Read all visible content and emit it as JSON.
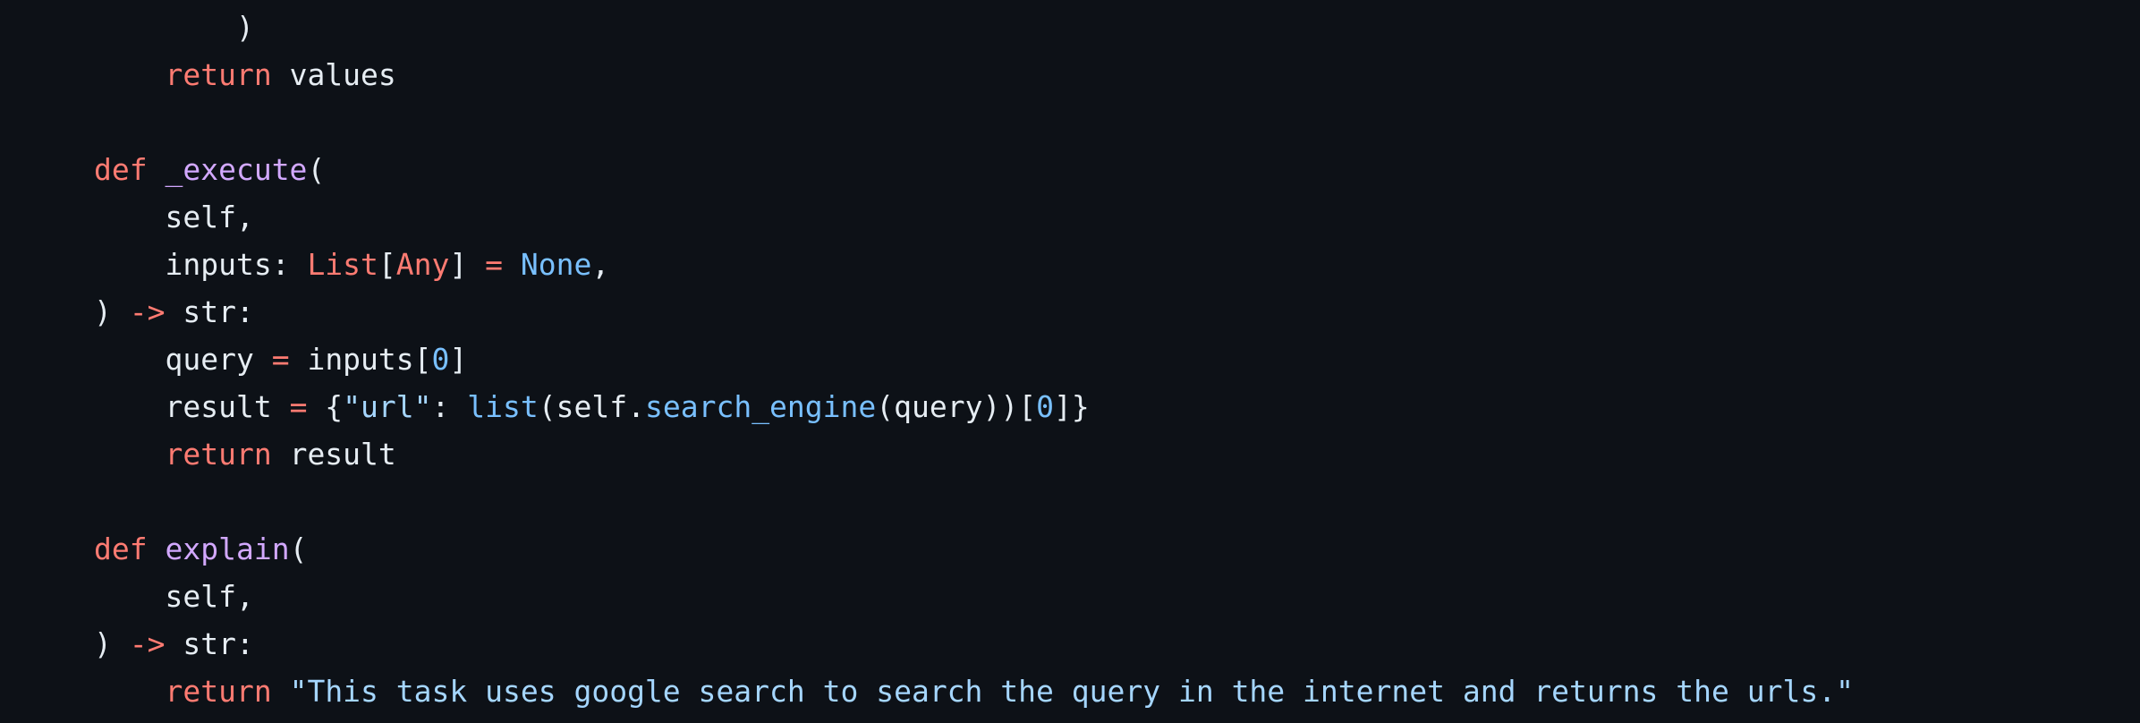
{
  "code_view": {
    "lines": [
      {
        "indent": "        ",
        "tokens": [
          {
            "text": ")",
            "kind": "plain"
          }
        ]
      },
      {
        "indent": "    ",
        "tokens": [
          {
            "text": "return",
            "kind": "keyword"
          },
          {
            "text": " values",
            "kind": "plain"
          }
        ]
      },
      {
        "indent": "",
        "tokens": []
      },
      {
        "indent": "",
        "tokens": [
          {
            "text": "def",
            "kind": "keyword"
          },
          {
            "text": " ",
            "kind": "plain"
          },
          {
            "text": "_execute",
            "kind": "function"
          },
          {
            "text": "(",
            "kind": "plain"
          }
        ]
      },
      {
        "indent": "    ",
        "tokens": [
          {
            "text": "self,",
            "kind": "plain"
          }
        ]
      },
      {
        "indent": "    ",
        "tokens": [
          {
            "text": "inputs: ",
            "kind": "plain"
          },
          {
            "text": "List",
            "kind": "type"
          },
          {
            "text": "[",
            "kind": "plain"
          },
          {
            "text": "Any",
            "kind": "type"
          },
          {
            "text": "] ",
            "kind": "plain"
          },
          {
            "text": "=",
            "kind": "operator"
          },
          {
            "text": " ",
            "kind": "plain"
          },
          {
            "text": "None",
            "kind": "constant"
          },
          {
            "text": ",",
            "kind": "plain"
          }
        ]
      },
      {
        "indent": "",
        "tokens": [
          {
            "text": ") ",
            "kind": "plain"
          },
          {
            "text": "->",
            "kind": "operator"
          },
          {
            "text": " str:",
            "kind": "plain"
          }
        ]
      },
      {
        "indent": "    ",
        "tokens": [
          {
            "text": "query ",
            "kind": "plain"
          },
          {
            "text": "=",
            "kind": "operator"
          },
          {
            "text": " inputs[",
            "kind": "plain"
          },
          {
            "text": "0",
            "kind": "number"
          },
          {
            "text": "]",
            "kind": "plain"
          }
        ]
      },
      {
        "indent": "    ",
        "tokens": [
          {
            "text": "result ",
            "kind": "plain"
          },
          {
            "text": "=",
            "kind": "operator"
          },
          {
            "text": " {",
            "kind": "plain"
          },
          {
            "text": "\"url\"",
            "kind": "string"
          },
          {
            "text": ": ",
            "kind": "plain"
          },
          {
            "text": "list",
            "kind": "builtin"
          },
          {
            "text": "(self.",
            "kind": "plain"
          },
          {
            "text": "search_engine",
            "kind": "builtin"
          },
          {
            "text": "(query))[",
            "kind": "plain"
          },
          {
            "text": "0",
            "kind": "number"
          },
          {
            "text": "]}",
            "kind": "plain"
          }
        ]
      },
      {
        "indent": "    ",
        "tokens": [
          {
            "text": "return",
            "kind": "keyword"
          },
          {
            "text": " result",
            "kind": "plain"
          }
        ]
      },
      {
        "indent": "",
        "tokens": []
      },
      {
        "indent": "",
        "tokens": [
          {
            "text": "def",
            "kind": "keyword"
          },
          {
            "text": " ",
            "kind": "plain"
          },
          {
            "text": "explain",
            "kind": "function"
          },
          {
            "text": "(",
            "kind": "plain"
          }
        ]
      },
      {
        "indent": "    ",
        "tokens": [
          {
            "text": "self,",
            "kind": "plain"
          }
        ]
      },
      {
        "indent": "",
        "tokens": [
          {
            "text": ") ",
            "kind": "plain"
          },
          {
            "text": "->",
            "kind": "operator"
          },
          {
            "text": " str:",
            "kind": "plain"
          }
        ]
      },
      {
        "indent": "    ",
        "tokens": [
          {
            "text": "return",
            "kind": "keyword"
          },
          {
            "text": " ",
            "kind": "plain"
          },
          {
            "text": "\"This task uses google search to search the query in the internet and returns the urls.\"",
            "kind": "string"
          }
        ]
      }
    ]
  },
  "theme": {
    "background": "#0d1117",
    "plain": "#e6edf3",
    "keyword": "#ff7b72",
    "function": "#d2a8ff",
    "constant": "#79c0ff",
    "string": "#a5d6ff"
  }
}
